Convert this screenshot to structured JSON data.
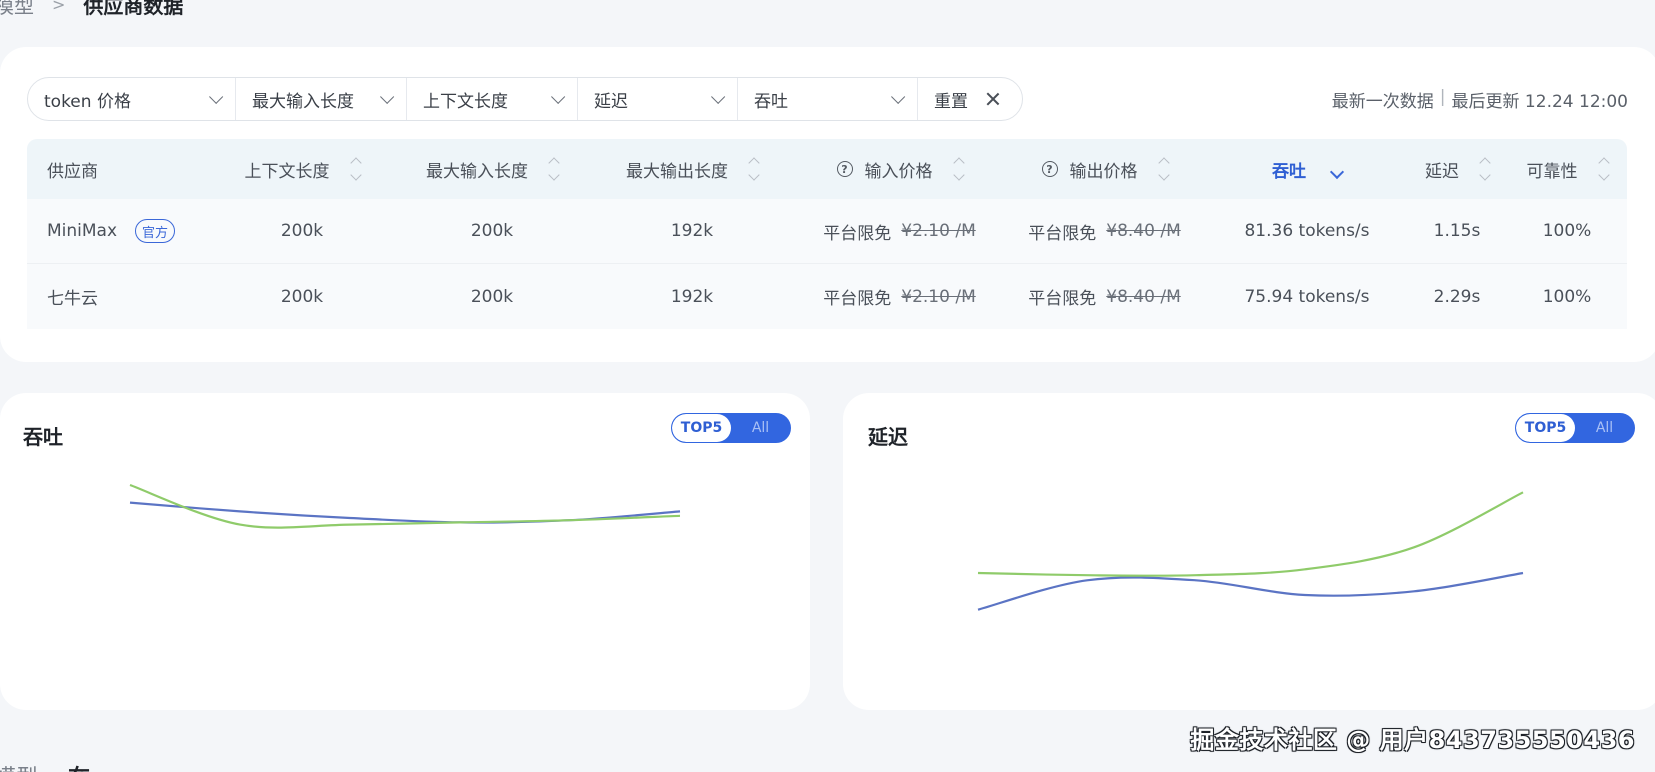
{
  "breadcrumb": {
    "parent": "模型",
    "separator": ">",
    "current": "供应商数据"
  },
  "filters": [
    {
      "label": "token 价格",
      "icon": "chevron-down-icon"
    },
    {
      "label": "最大输入长度",
      "icon": "chevron-down-icon"
    },
    {
      "label": "上下文长度",
      "icon": "chevron-down-icon"
    },
    {
      "label": "延迟",
      "icon": "chevron-down-icon"
    },
    {
      "label": "吞吐",
      "icon": "chevron-down-icon"
    }
  ],
  "reset": {
    "label": "重置",
    "icon": "close-icon"
  },
  "update_info": {
    "latest": "最新一次数据",
    "divider": "|",
    "updated": "最后更新 12.24 12:00"
  },
  "table": {
    "headers": {
      "provider": "供应商",
      "context": "上下文长度",
      "max_input": "最大输入长度",
      "max_output": "最大输出长度",
      "input_price": "输入价格",
      "output_price": "输出价格",
      "throughput": "吞吐",
      "latency": "延迟",
      "reliability": "可靠性"
    },
    "help_glyph": "?",
    "sorted_column": "throughput",
    "rows": [
      {
        "provider": "MiniMax",
        "badge": "官方",
        "context": "200k",
        "max_input": "200k",
        "max_output": "192k",
        "input_free": "平台限免",
        "input_old": "¥2.10 /M",
        "output_free": "平台限免",
        "output_old": "¥8.40 /M",
        "throughput": "81.36 tokens/s",
        "latency": "1.15s",
        "reliability": "100%"
      },
      {
        "provider": "七牛云",
        "badge": "",
        "context": "200k",
        "max_input": "200k",
        "max_output": "192k",
        "input_free": "平台限免",
        "input_old": "¥2.10 /M",
        "output_free": "平台限免",
        "output_old": "¥8.40 /M",
        "throughput": "75.94 tokens/s",
        "latency": "2.29s",
        "reliability": "100%"
      }
    ]
  },
  "charts": {
    "throughput": {
      "title": "吞吐",
      "toggle": {
        "active": "TOP5",
        "inactive": "All"
      }
    },
    "latency": {
      "title": "延迟",
      "toggle": {
        "active": "TOP5",
        "inactive": "All"
      }
    }
  },
  "chart_data": [
    {
      "type": "line",
      "title": "吞吐",
      "xlabel": "",
      "ylabel": "",
      "x": [
        0,
        1,
        2,
        3,
        4,
        5
      ],
      "ylim": [
        0,
        100
      ],
      "grid": false,
      "colors": [
        "#5b74c4",
        "#8fcb6a"
      ],
      "series": [
        {
          "values": [
            82,
            78,
            75,
            73,
            74,
            78
          ]
        },
        {
          "values": [
            90,
            72,
            72,
            73,
            74,
            76
          ]
        }
      ]
    },
    {
      "type": "line",
      "title": "延迟",
      "xlabel": "",
      "ylabel": "",
      "x": [
        0,
        1,
        2,
        3,
        4,
        5
      ],
      "ylim": [
        0,
        3
      ],
      "grid": false,
      "colors": [
        "#5b74c4",
        "#8fcb6a"
      ],
      "series": [
        {
          "values": [
            1.0,
            1.4,
            1.4,
            1.2,
            1.25,
            1.5
          ]
        },
        {
          "values": [
            1.5,
            1.47,
            1.47,
            1.55,
            1.85,
            2.6
          ]
        }
      ]
    }
  ],
  "watermark": "掘金技术社区 @ 用户843735550436",
  "bottom_row": {
    "left": "模型",
    "text": "在"
  }
}
